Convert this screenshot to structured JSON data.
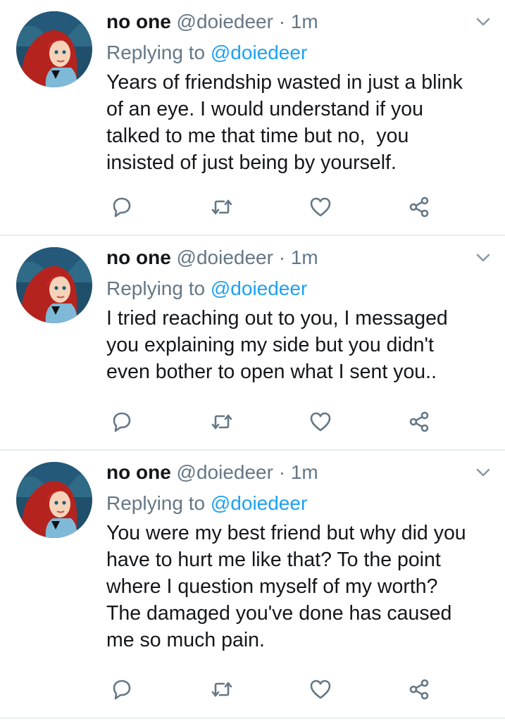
{
  "colors": {
    "text": "#14171a",
    "secondary": "#657786",
    "link": "#1da1f2",
    "divider": "#e6ecf0"
  },
  "tweets": [
    {
      "name": "no one",
      "handle": "@doiedeer",
      "separator": "·",
      "time": "1m",
      "reply_prefix": "Replying to",
      "reply_to": "@doiedeer",
      "text": "Years of friendship wasted in just a blink\nof an eye. I would understand if you\ntalked to me that time but no,  you\ninsisted of just being by yourself."
    },
    {
      "name": "no one",
      "handle": "@doiedeer",
      "separator": "·",
      "time": "1m",
      "reply_prefix": "Replying to",
      "reply_to": "@doiedeer",
      "text": "I tried reaching out to you, I messaged\nyou explaining my side but you didn't\neven bother to open what I sent you.."
    },
    {
      "name": "no one",
      "handle": "@doiedeer",
      "separator": "·",
      "time": "1m",
      "reply_prefix": "Replying to",
      "reply_to": "@doiedeer",
      "text": "You were my best friend but why did you\nhave to hurt me like that? To the point\nwhere I question myself of my worth?\nThe damaged you've done has caused\nme so much pain."
    }
  ],
  "icons": {
    "avatar": "avatar-image",
    "caret": "chevron-down-icon",
    "reply": "reply-icon",
    "retweet": "retweet-icon",
    "like": "heart-icon",
    "share": "share-icon"
  }
}
